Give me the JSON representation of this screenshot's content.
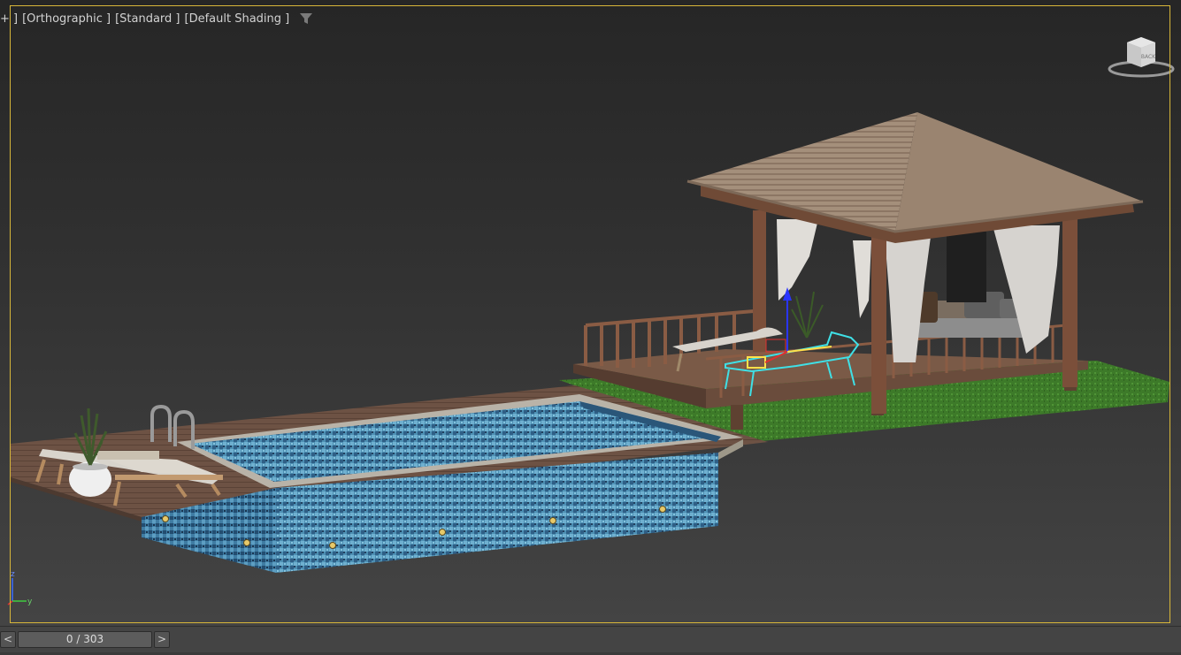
{
  "viewport": {
    "plus_label": "+ ]",
    "view_label": "[Orthographic ]",
    "mode_label": "[Standard ]",
    "shading_label": "[Default Shading ]",
    "filter_icon": "funnel-icon",
    "viewcube_label": "BACK",
    "axis": {
      "z": "z",
      "y": "y"
    }
  },
  "timeline": {
    "prev_label": "<",
    "next_label": ">",
    "frame_label": "0 / 303"
  },
  "colors": {
    "viewport_border": "#d8b73a",
    "selection": "#3fe0e6",
    "grass": "#3f7a2a",
    "deck": "#6b5040",
    "pool_tile": "#4a90b8",
    "roof": "#a08b78"
  }
}
